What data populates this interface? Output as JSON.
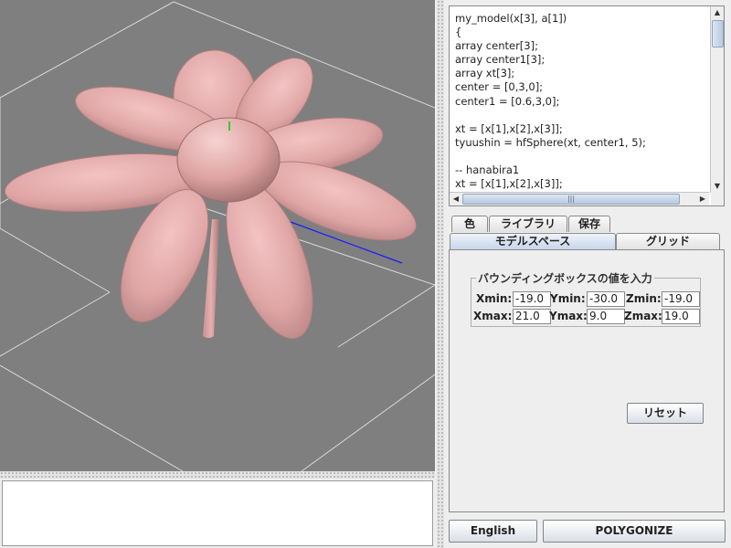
{
  "code_editor": {
    "lines": [
      "my_model(x[3], a[1])",
      "{",
      "array center[3];",
      "array center1[3];",
      "array xt[3];",
      "center = [0,3,0];",
      "center1 = [0.6,3,0];",
      "",
      "xt = [x[1],x[2],x[3]];",
      "tyuushin = hfSphere(xt, center1, 5);",
      "",
      "-- hanabira1",
      "xt = [x[1],x[2],x[3]];"
    ],
    "hscroll_grip": "|||"
  },
  "tabs": {
    "row_top": [
      "色",
      "ライブラリ",
      "保存"
    ],
    "row_bottom": [
      "モデルスペース",
      "グリッド"
    ],
    "selected": "モデルスペース"
  },
  "bounding_box": {
    "title": "バウンディングボックスの値を入力",
    "xmin_label": "Xmin:",
    "xmin": "-19.0",
    "ymin_label": "Ymin:",
    "ymin": "-30.0",
    "zmin_label": "Zmin:",
    "zmin": "-19.0",
    "xmax_label": "Xmax:",
    "xmax": "21.0",
    "ymax_label": "Ymax:",
    "ymax": "9.0",
    "zmax_label": "Zmax:",
    "zmax": "19.0"
  },
  "buttons": {
    "reset": "リセット",
    "language": "English",
    "polygonize": "POLYGONIZE"
  },
  "icons": {
    "scroll_up": "▲",
    "scroll_down": "▼",
    "scroll_left": "◀",
    "scroll_right": "▶"
  },
  "colors": {
    "viewport_bg": "#7f7f7f",
    "petal": "#e2a9a9",
    "axis_x": "#1a1aff",
    "axis_y": "#00cc00"
  }
}
